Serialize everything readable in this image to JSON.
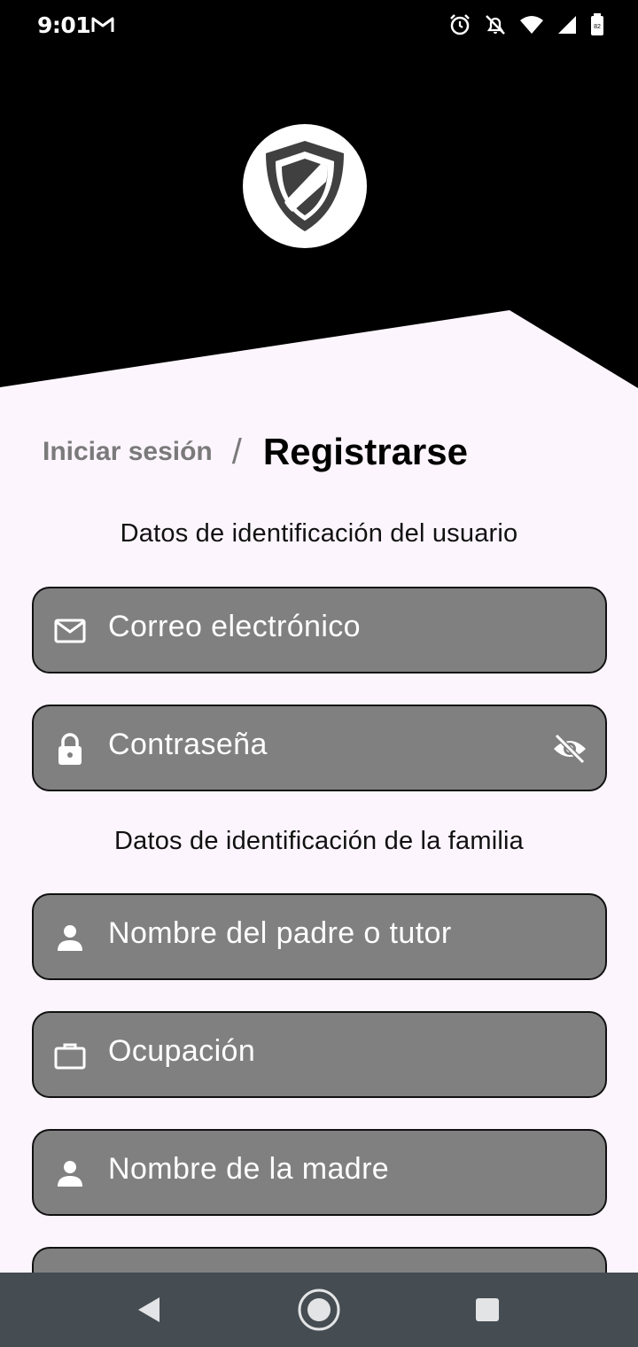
{
  "status_bar": {
    "time": "9:01",
    "icons": [
      "gmail-icon",
      "alarm-icon",
      "notifications-off-icon",
      "wifi-icon",
      "signal-icon",
      "battery-icon"
    ],
    "battery_level": "82"
  },
  "header": {
    "background": "#000000",
    "logo_icon": "shield-icon"
  },
  "auth_tabs": {
    "login_label": "Iniciar sesión",
    "separator": "/",
    "register_label": "Registrarse"
  },
  "sections": {
    "user_title": "Datos de identificación del usuario",
    "family_title": "Datos de identificación de la familia"
  },
  "fields": {
    "email": {
      "placeholder": "Correo electrónico",
      "icon": "mail-icon"
    },
    "password": {
      "placeholder": "Contraseña",
      "icon": "lock-icon",
      "trailing_icon": "visibility-off-icon"
    },
    "father_name": {
      "placeholder": "Nombre del padre o tutor",
      "icon": "person-icon"
    },
    "occupation": {
      "placeholder": "Ocupación",
      "icon": "briefcase-icon"
    },
    "mother_name": {
      "placeholder": "Nombre de la madre",
      "icon": "person-icon"
    }
  },
  "colors": {
    "page_background": "#fcf5fd",
    "field_fill": "#808080",
    "nav_bar": "#454c52"
  },
  "nav_bar": {
    "buttons": [
      "back-icon",
      "home-icon",
      "recents-icon"
    ]
  }
}
